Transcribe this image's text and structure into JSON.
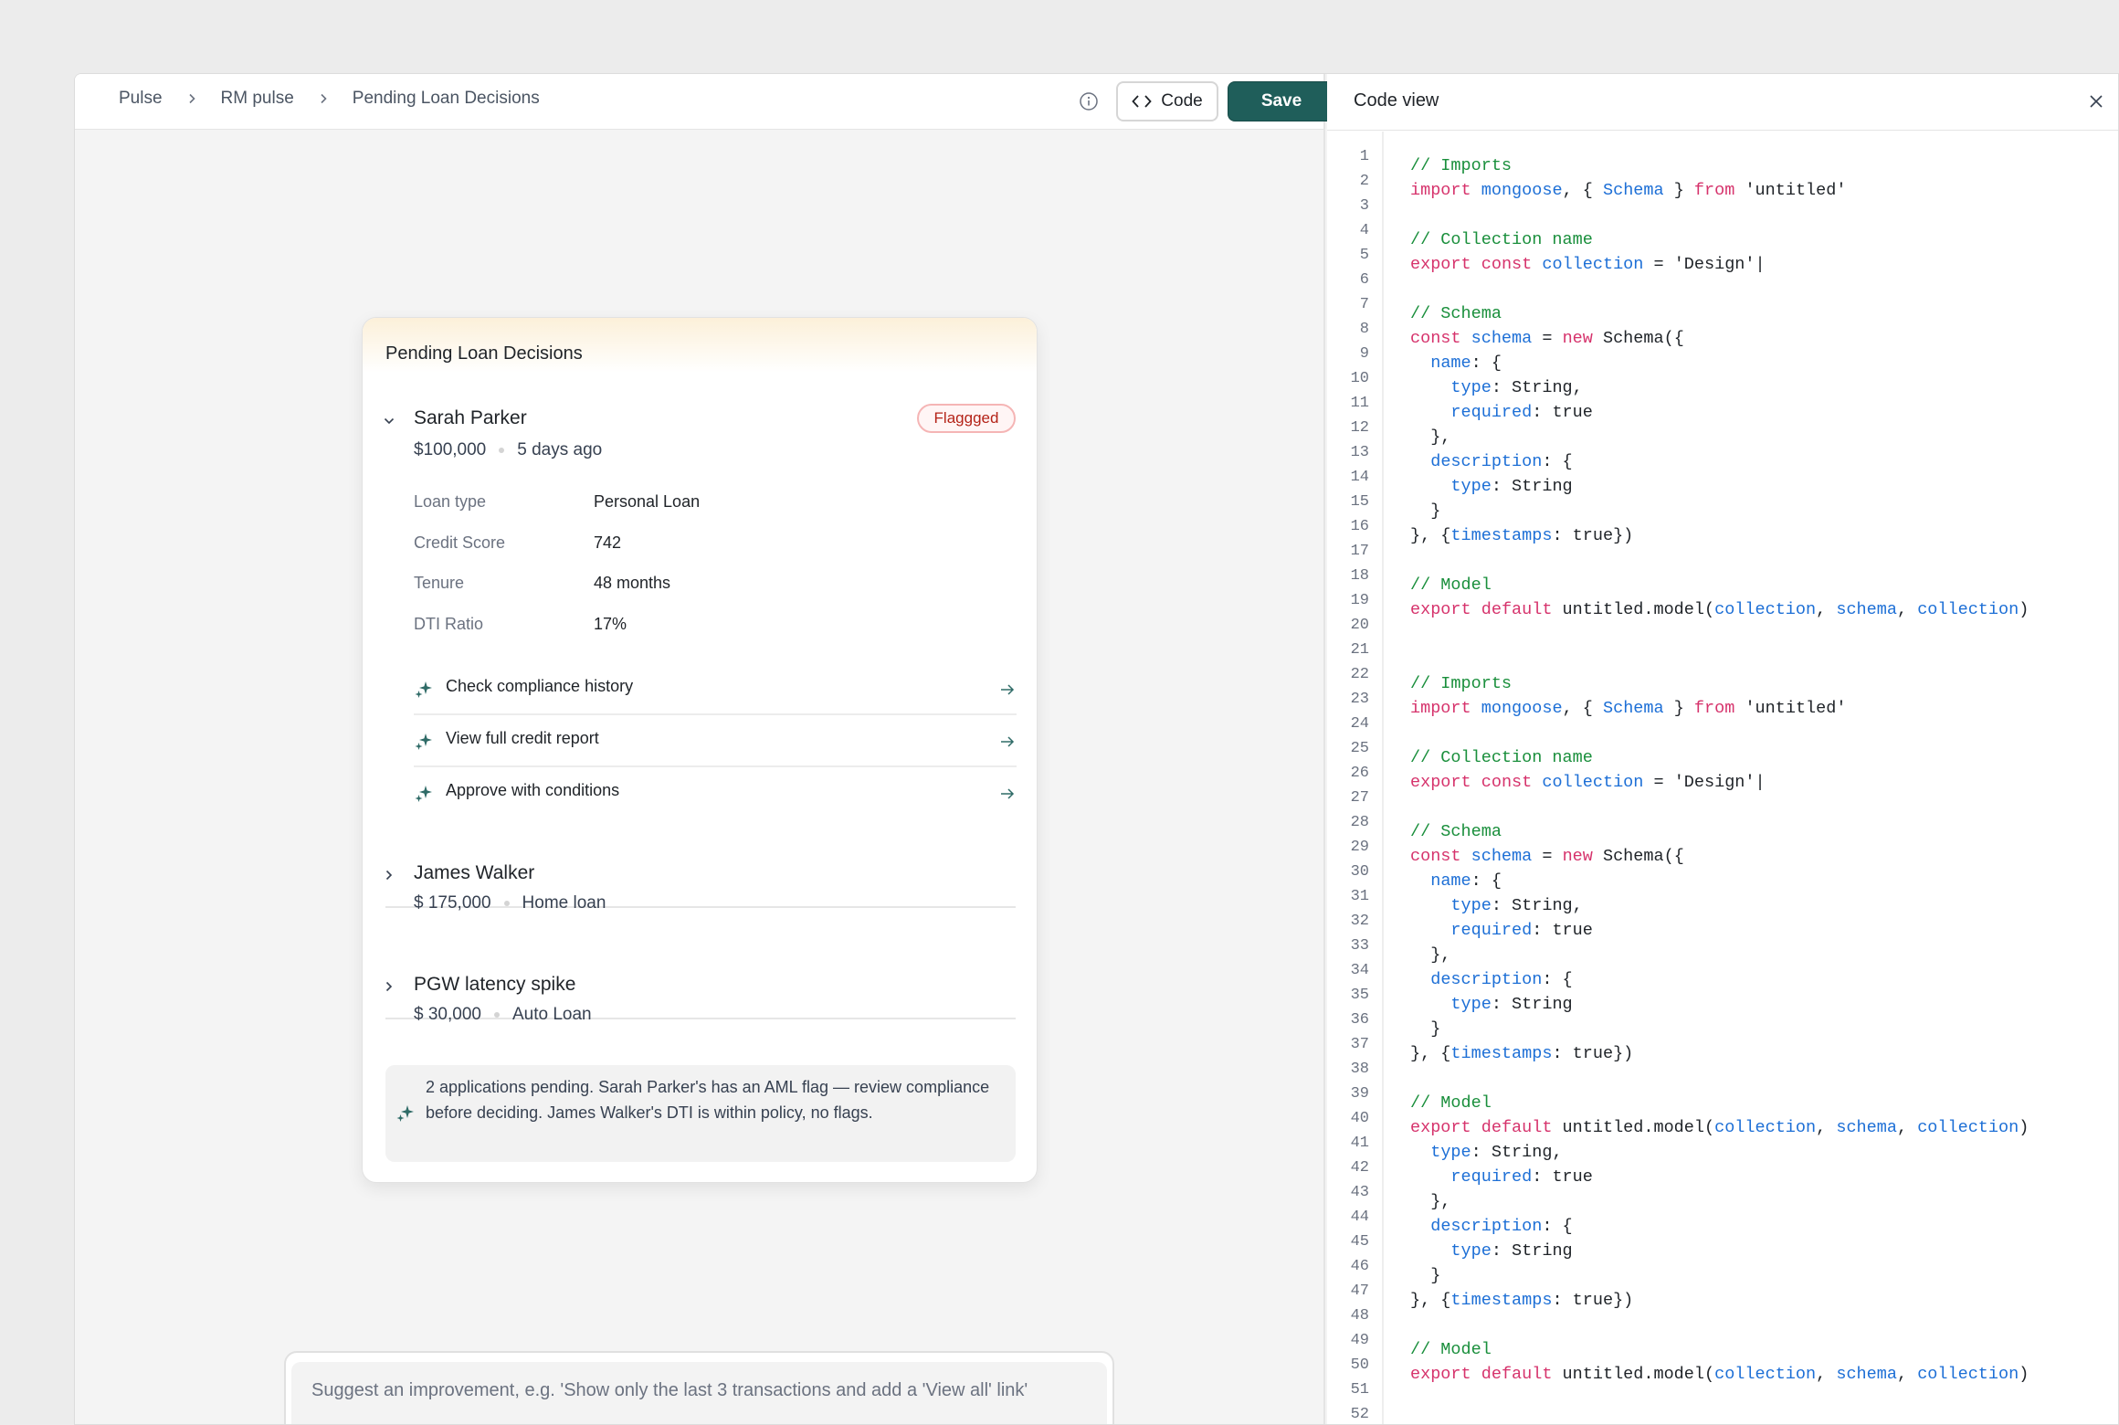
{
  "breadcrumb": [
    "Pulse",
    "RM pulse",
    "Pending Loan Decisions"
  ],
  "toolbar": {
    "code_label": "Code",
    "save_label": "Save"
  },
  "card": {
    "title": "Pending Loan Decisions",
    "applicants": [
      {
        "name": "Sarah Parker",
        "amount": "$100,000",
        "detail": "5 days ago",
        "badge": "Flaggged",
        "expanded": true,
        "fields": [
          {
            "label": "Loan type",
            "value": "Personal Loan"
          },
          {
            "label": "Credit Score",
            "value": "742"
          },
          {
            "label": "Tenure",
            "value": "48 months"
          },
          {
            "label": "DTI Ratio",
            "value": "17%"
          }
        ],
        "actions": [
          "Check compliance history",
          "View full credit report",
          "Approve with conditions"
        ]
      },
      {
        "name": "James Walker",
        "amount": "$ 175,000",
        "detail": "Home loan",
        "expanded": false
      },
      {
        "name": "PGW latency spike",
        "amount": "$ 30,000",
        "detail": "Auto Loan",
        "expanded": false
      }
    ],
    "summary": "2 applications pending. Sarah Parker's has an AML flag — review compliance before deciding. James Walker's DTI is within policy, no flags."
  },
  "suggest": {
    "placeholder": "Suggest an improvement, e.g. 'Show only the last 3 transactions and add a 'View all' link'"
  },
  "code_view": {
    "title": "Code view",
    "lines": [
      [
        [
          "c",
          "// Imports"
        ]
      ],
      [
        [
          "k",
          "import"
        ],
        [
          "p",
          " "
        ],
        [
          "i",
          "mongoose"
        ],
        [
          "p",
          ", { "
        ],
        [
          "i",
          "Schema"
        ],
        [
          "p",
          " } "
        ],
        [
          "k",
          "from"
        ],
        [
          "p",
          " 'untitled'"
        ]
      ],
      [],
      [
        [
          "c",
          "// Collection name"
        ]
      ],
      [
        [
          "k",
          "export"
        ],
        [
          "p",
          " "
        ],
        [
          "k",
          "const"
        ],
        [
          "p",
          " "
        ],
        [
          "i",
          "collection"
        ],
        [
          "p",
          " = 'Design'|"
        ]
      ],
      [],
      [
        [
          "c",
          "// Schema"
        ]
      ],
      [
        [
          "k",
          "const"
        ],
        [
          "p",
          " "
        ],
        [
          "i",
          "schema"
        ],
        [
          "p",
          " = "
        ],
        [
          "k",
          "new"
        ],
        [
          "p",
          " Schema({"
        ]
      ],
      [
        [
          "p",
          "  "
        ],
        [
          "i",
          "name"
        ],
        [
          "p",
          ": {"
        ]
      ],
      [
        [
          "p",
          "    "
        ],
        [
          "i",
          "type"
        ],
        [
          "p",
          ": String,"
        ]
      ],
      [
        [
          "p",
          "    "
        ],
        [
          "i",
          "required"
        ],
        [
          "p",
          ": true"
        ]
      ],
      [
        [
          "p",
          "  },"
        ]
      ],
      [
        [
          "p",
          "  "
        ],
        [
          "i",
          "description"
        ],
        [
          "p",
          ": {"
        ]
      ],
      [
        [
          "p",
          "    "
        ],
        [
          "i",
          "type"
        ],
        [
          "p",
          ": String"
        ]
      ],
      [
        [
          "p",
          "  }"
        ]
      ],
      [
        [
          "p",
          "}, {"
        ],
        [
          "i",
          "timestamps"
        ],
        [
          "p",
          ": true})"
        ]
      ],
      [],
      [
        [
          "c",
          "// Model"
        ]
      ],
      [
        [
          "k",
          "export"
        ],
        [
          "p",
          " "
        ],
        [
          "k",
          "default"
        ],
        [
          "p",
          " untitled.model("
        ],
        [
          "i",
          "collection"
        ],
        [
          "p",
          ", "
        ],
        [
          "i",
          "schema"
        ],
        [
          "p",
          ", "
        ],
        [
          "i",
          "collection"
        ],
        [
          "p",
          ")"
        ]
      ],
      [],
      [],
      [
        [
          "c",
          "// Imports"
        ]
      ],
      [
        [
          "k",
          "import"
        ],
        [
          "p",
          " "
        ],
        [
          "i",
          "mongoose"
        ],
        [
          "p",
          ", { "
        ],
        [
          "i",
          "Schema"
        ],
        [
          "p",
          " } "
        ],
        [
          "k",
          "from"
        ],
        [
          "p",
          " 'untitled'"
        ]
      ],
      [],
      [
        [
          "c",
          "// Collection name"
        ]
      ],
      [
        [
          "k",
          "export"
        ],
        [
          "p",
          " "
        ],
        [
          "k",
          "const"
        ],
        [
          "p",
          " "
        ],
        [
          "i",
          "collection"
        ],
        [
          "p",
          " = 'Design'|"
        ]
      ],
      [],
      [
        [
          "c",
          "// Schema"
        ]
      ],
      [
        [
          "k",
          "const"
        ],
        [
          "p",
          " "
        ],
        [
          "i",
          "schema"
        ],
        [
          "p",
          " = "
        ],
        [
          "k",
          "new"
        ],
        [
          "p",
          " Schema({"
        ]
      ],
      [
        [
          "p",
          "  "
        ],
        [
          "i",
          "name"
        ],
        [
          "p",
          ": {"
        ]
      ],
      [
        [
          "p",
          "    "
        ],
        [
          "i",
          "type"
        ],
        [
          "p",
          ": String,"
        ]
      ],
      [
        [
          "p",
          "    "
        ],
        [
          "i",
          "required"
        ],
        [
          "p",
          ": true"
        ]
      ],
      [
        [
          "p",
          "  },"
        ]
      ],
      [
        [
          "p",
          "  "
        ],
        [
          "i",
          "description"
        ],
        [
          "p",
          ": {"
        ]
      ],
      [
        [
          "p",
          "    "
        ],
        [
          "i",
          "type"
        ],
        [
          "p",
          ": String"
        ]
      ],
      [
        [
          "p",
          "  }"
        ]
      ],
      [
        [
          "p",
          "}, {"
        ],
        [
          "i",
          "timestamps"
        ],
        [
          "p",
          ": true})"
        ]
      ],
      [],
      [
        [
          "c",
          "// Model"
        ]
      ],
      [
        [
          "k",
          "export"
        ],
        [
          "p",
          " "
        ],
        [
          "k",
          "default"
        ],
        [
          "p",
          " untitled.model("
        ],
        [
          "i",
          "collection"
        ],
        [
          "p",
          ", "
        ],
        [
          "i",
          "schema"
        ],
        [
          "p",
          ", "
        ],
        [
          "i",
          "collection"
        ],
        [
          "p",
          ")"
        ]
      ],
      [
        [
          "p",
          "  "
        ],
        [
          "i",
          "type"
        ],
        [
          "p",
          ": String,"
        ]
      ],
      [
        [
          "p",
          "    "
        ],
        [
          "i",
          "required"
        ],
        [
          "p",
          ": true"
        ]
      ],
      [
        [
          "p",
          "  },"
        ]
      ],
      [
        [
          "p",
          "  "
        ],
        [
          "i",
          "description"
        ],
        [
          "p",
          ": {"
        ]
      ],
      [
        [
          "p",
          "    "
        ],
        [
          "i",
          "type"
        ],
        [
          "p",
          ": String"
        ]
      ],
      [
        [
          "p",
          "  }"
        ]
      ],
      [
        [
          "p",
          "}, {"
        ],
        [
          "i",
          "timestamps"
        ],
        [
          "p",
          ": true})"
        ]
      ],
      [],
      [
        [
          "c",
          "// Model"
        ]
      ],
      [
        [
          "k",
          "export"
        ],
        [
          "p",
          " "
        ],
        [
          "k",
          "default"
        ],
        [
          "p",
          " untitled.model("
        ],
        [
          "i",
          "collection"
        ],
        [
          "p",
          ", "
        ],
        [
          "i",
          "schema"
        ],
        [
          "p",
          ", "
        ],
        [
          "i",
          "collection"
        ],
        [
          "p",
          ")"
        ]
      ],
      [],
      [],
      []
    ]
  },
  "colors": {
    "accent": "#1f5e5a",
    "flag": "#b42318",
    "comment": "#1a8f3c",
    "keyword": "#d6336c",
    "identifier": "#1d6fd6"
  },
  "icons": [
    "chevron-right-icon",
    "info-icon",
    "code-icon",
    "chevron-down-icon",
    "sparkle-icon",
    "arrow-right-icon",
    "close-icon"
  ]
}
